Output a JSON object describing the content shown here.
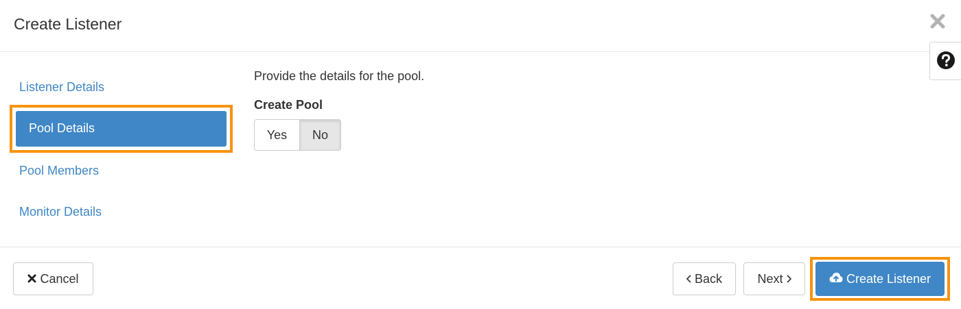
{
  "dialog": {
    "title": "Create Listener",
    "close_icon": "close-icon",
    "help_icon": "question-circle-icon"
  },
  "nav": {
    "items": [
      {
        "label": "Listener Details",
        "active": false
      },
      {
        "label": "Pool Details",
        "active": true
      },
      {
        "label": "Pool Members",
        "active": false
      },
      {
        "label": "Monitor Details",
        "active": false
      }
    ]
  },
  "pool_step": {
    "description": "Provide the details for the pool.",
    "create_pool_label": "Create Pool",
    "options": [
      "Yes",
      "No"
    ],
    "selected": "No"
  },
  "footer": {
    "cancel_label": "Cancel",
    "back_label": "Back",
    "next_label": "Next",
    "create_label": "Create Listener"
  },
  "colors": {
    "accent": "#3f87c6",
    "highlight": "#f7930d"
  }
}
